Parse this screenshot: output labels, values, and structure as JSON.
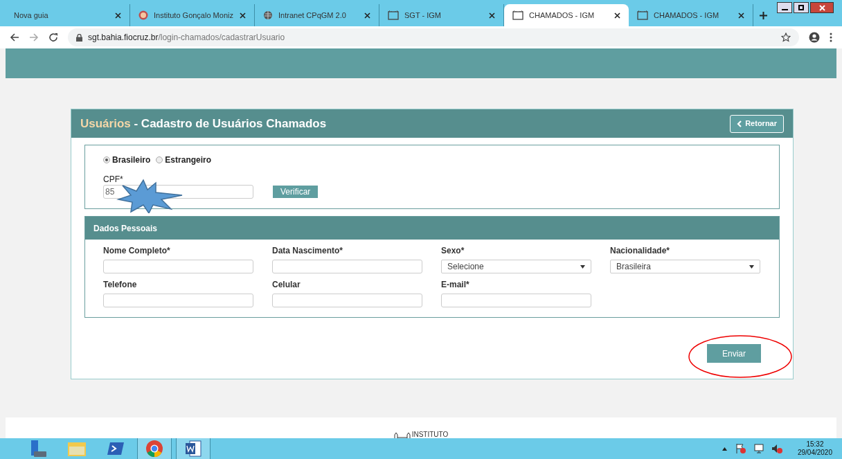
{
  "browser": {
    "tabs": [
      {
        "title": "Nova guia",
        "kind": "blank",
        "selected": false
      },
      {
        "title": "Instituto Gonçalo Moniz",
        "kind": "seal",
        "selected": false
      },
      {
        "title": "Intranet CPqGM 2.0",
        "kind": "globe",
        "selected": false
      },
      {
        "title": "SGT - IGM",
        "kind": "page",
        "selected": false
      },
      {
        "title": "CHAMADOS - IGM",
        "kind": "page",
        "selected": true
      },
      {
        "title": "CHAMADOS - IGM",
        "kind": "page",
        "selected": false
      }
    ],
    "url_host": "sgt.bahia.fiocruz.br",
    "url_path": "/login-chamados/cadastrarUsuario"
  },
  "panel": {
    "title_highlight": "Usuários",
    "title_rest": " - Cadastro de Usuários Chamados",
    "back_button": "Retornar",
    "nationality": [
      {
        "label": "Brasileiro",
        "selected": true
      },
      {
        "label": "Estrangeiro",
        "selected": false
      }
    ],
    "cpf_label": "CPF*",
    "cpf_value": "85",
    "verify_button": "Verificar",
    "section_title": "Dados Pessoais",
    "fields": [
      {
        "label": "Nome Completo*",
        "kind": "text"
      },
      {
        "label": "Data Nascimento*",
        "kind": "text"
      },
      {
        "label": "Sexo*",
        "kind": "select",
        "value": "Selecione"
      },
      {
        "label": "Nacionalidade*",
        "kind": "select",
        "value": "Brasileira"
      },
      {
        "label": "Telefone",
        "kind": "text"
      },
      {
        "label": "Celular",
        "kind": "text"
      },
      {
        "label": "E-mail*",
        "kind": "text"
      }
    ],
    "submit_button": "Enviar"
  },
  "footer": {
    "text": "INSTITUTO"
  },
  "taskbar": {
    "apps": [
      {
        "kind": "server",
        "active": false
      },
      {
        "kind": "folder",
        "active": false
      },
      {
        "kind": "shell",
        "active": false
      },
      {
        "kind": "chrome",
        "active": true
      },
      {
        "kind": "word",
        "active": true
      }
    ],
    "time": "15:32",
    "date": "29/04/2020"
  }
}
